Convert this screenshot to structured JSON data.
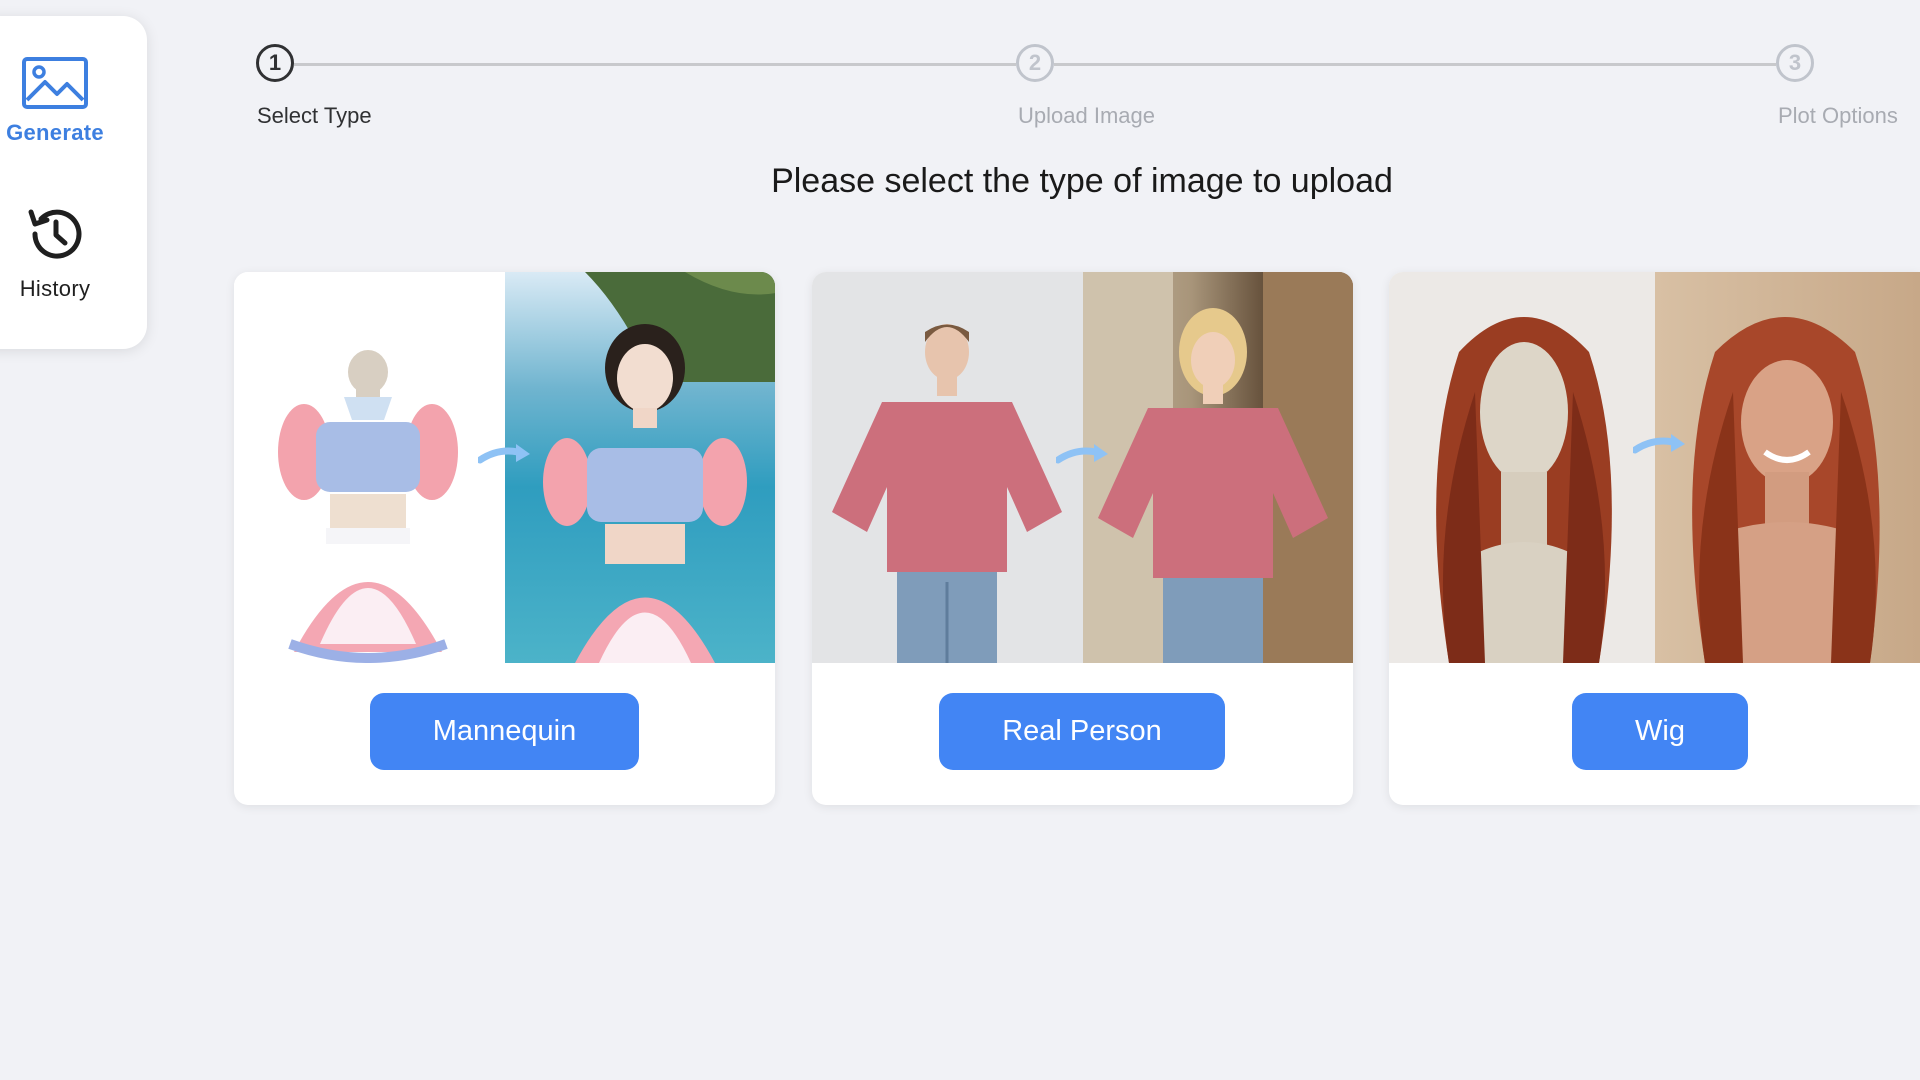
{
  "sidebar": {
    "items": [
      {
        "label": "Generate",
        "icon": "image-icon",
        "active": true
      },
      {
        "label": "History",
        "icon": "history-icon",
        "active": false
      }
    ]
  },
  "steps": [
    {
      "number": "1",
      "title": "Select Type",
      "status": "active"
    },
    {
      "number": "2",
      "title": "Upload Image",
      "status": "pending"
    },
    {
      "number": "3",
      "title": "Plot Options",
      "status": "pending"
    }
  ],
  "main": {
    "heading": "Please select the type of image to upload"
  },
  "cards": [
    {
      "button_label": "Mannequin"
    },
    {
      "button_label": "Real Person"
    },
    {
      "button_label": "Wig"
    }
  ],
  "colors": {
    "accent": "#4285f4",
    "nav_active": "#3d7fe0",
    "background": "#f1f2f6"
  }
}
